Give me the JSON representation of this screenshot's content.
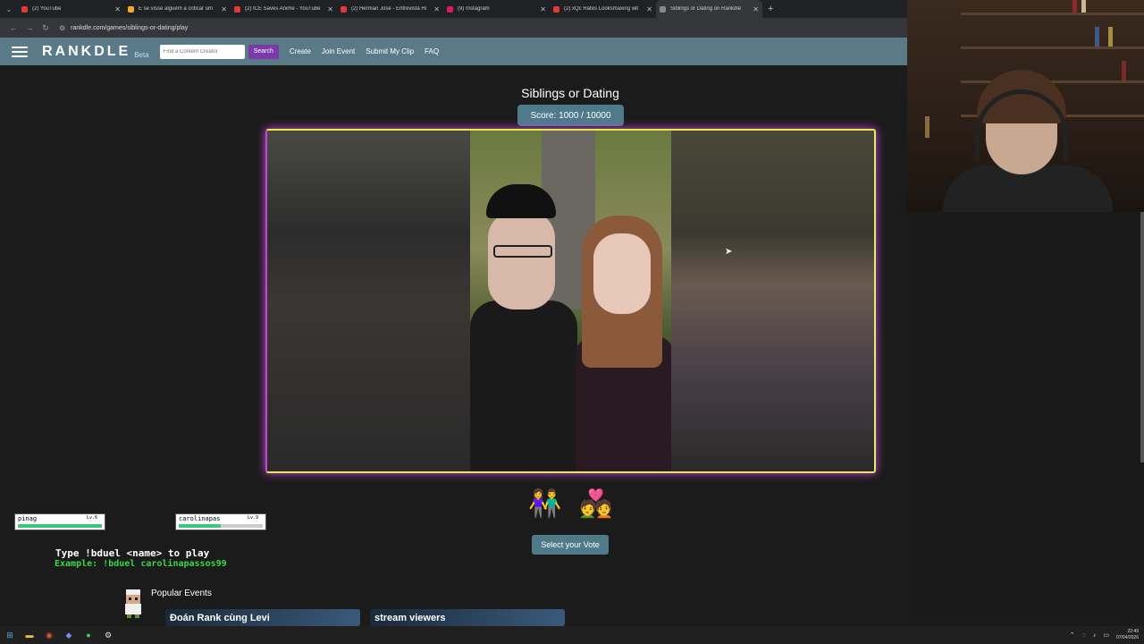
{
  "browser": {
    "tabs": [
      {
        "label": "(2) YouTube",
        "color": "#e53935"
      },
      {
        "label": "E se visse alguém a criticar um",
        "color": "#f9a825"
      },
      {
        "label": "(2) ICE Saves Anime - YouTube",
        "color": "#e53935"
      },
      {
        "label": "(2) Herman José - Entrevista Hi",
        "color": "#e53935"
      },
      {
        "label": "(9) Instagram",
        "color": "#d81b60"
      },
      {
        "label": "(2) xQc Rates Looksmaxing wit",
        "color": "#e53935"
      },
      {
        "label": "Siblings or Dating on Rankdle",
        "color": "#888888"
      }
    ],
    "url": "rankdle.com/games/siblings-or-dating/play"
  },
  "site": {
    "logo": "RANKDLE",
    "beta": "Beta",
    "search_placeholder": "Find a Content Creator",
    "search_button": "Search",
    "nav": [
      "Create",
      "Join Event",
      "Submit My Clip",
      "FAQ"
    ]
  },
  "game": {
    "title": "Siblings or Dating",
    "score": "Score: 1000 / 10000",
    "vote_button": "Select your Vote",
    "choice_siblings_icon": "siblings-icon",
    "choice_dating_icon": "dating-icon"
  },
  "overlay": {
    "players": [
      {
        "name": "pinag",
        "level": "Lv.6",
        "hp": 1.0
      },
      {
        "name": "carolinapas",
        "level": "Lv.9",
        "hp": 0.5
      }
    ],
    "duel_line1": "Type !bduel <name> to play",
    "duel_line2": "Example: !bduel carolinapassos99"
  },
  "events": {
    "title": "Popular Events",
    "cards": [
      "Đoán Rank cùng Levi",
      "stream viewers"
    ]
  },
  "taskbar": {
    "time": "22:49",
    "date": "07/04/2026"
  },
  "colors": {
    "accent": "#4e7a8a",
    "header": "#5a7a88",
    "search_button": "#7a3aa8",
    "frame_glow_left": "#c04ad0",
    "frame_glow_right": "#e8e84a"
  }
}
